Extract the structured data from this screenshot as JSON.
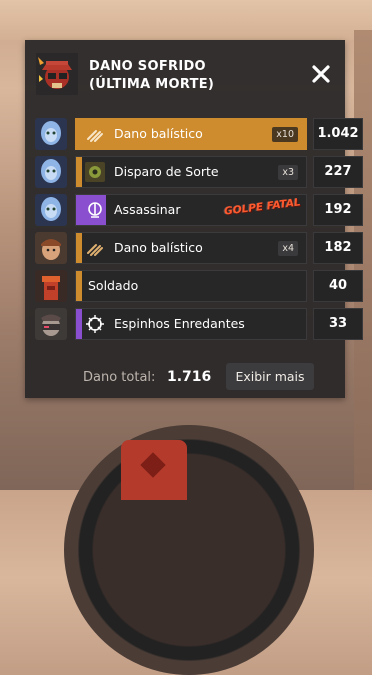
{
  "header": {
    "title_line1": "DANO SOFRIDO",
    "title_line2": "(ÚLTIMA MORTE)",
    "icon": "skull-hat-icon",
    "close_icon": "close-icon"
  },
  "colors": {
    "accent_orange": "#ce8c2e",
    "purple": "#8a4fcf",
    "fatal_red": "#ff5a2e",
    "panel_bg": "#2a2828"
  },
  "rows": [
    {
      "avatar": "ghost-hero-avatar",
      "icon": "ballistic-icon",
      "label": "Dano balístico",
      "multiplier": "x10",
      "value": "1.042",
      "style": "orange"
    },
    {
      "avatar": "ghost-hero-avatar",
      "icon": "lucky-shot-icon",
      "label": "Disparo de Sorte",
      "multiplier": "x3",
      "value": "227",
      "style": "dark-orange"
    },
    {
      "avatar": "ghost-hero-avatar",
      "icon": "assassinate-icon",
      "label": "Assassinar",
      "fatal": "GOLPE FATAL",
      "value": "192",
      "style": "dark-purple"
    },
    {
      "avatar": "soldier-hero-avatar",
      "icon": "ballistic-icon",
      "label": "Dano balístico",
      "multiplier": "x4",
      "value": "182",
      "style": "dark-orange"
    },
    {
      "avatar": "tower-avatar",
      "label": "Soldado",
      "value": "40",
      "style": "dark-orange"
    },
    {
      "avatar": "masked-hero-avatar",
      "icon": "thorns-icon",
      "label": "Espinhos Enredantes",
      "value": "33",
      "style": "dark-purple"
    }
  ],
  "footer": {
    "total_label": "Dano total:",
    "total_value": "1.716",
    "more_button": "Exibir mais"
  }
}
